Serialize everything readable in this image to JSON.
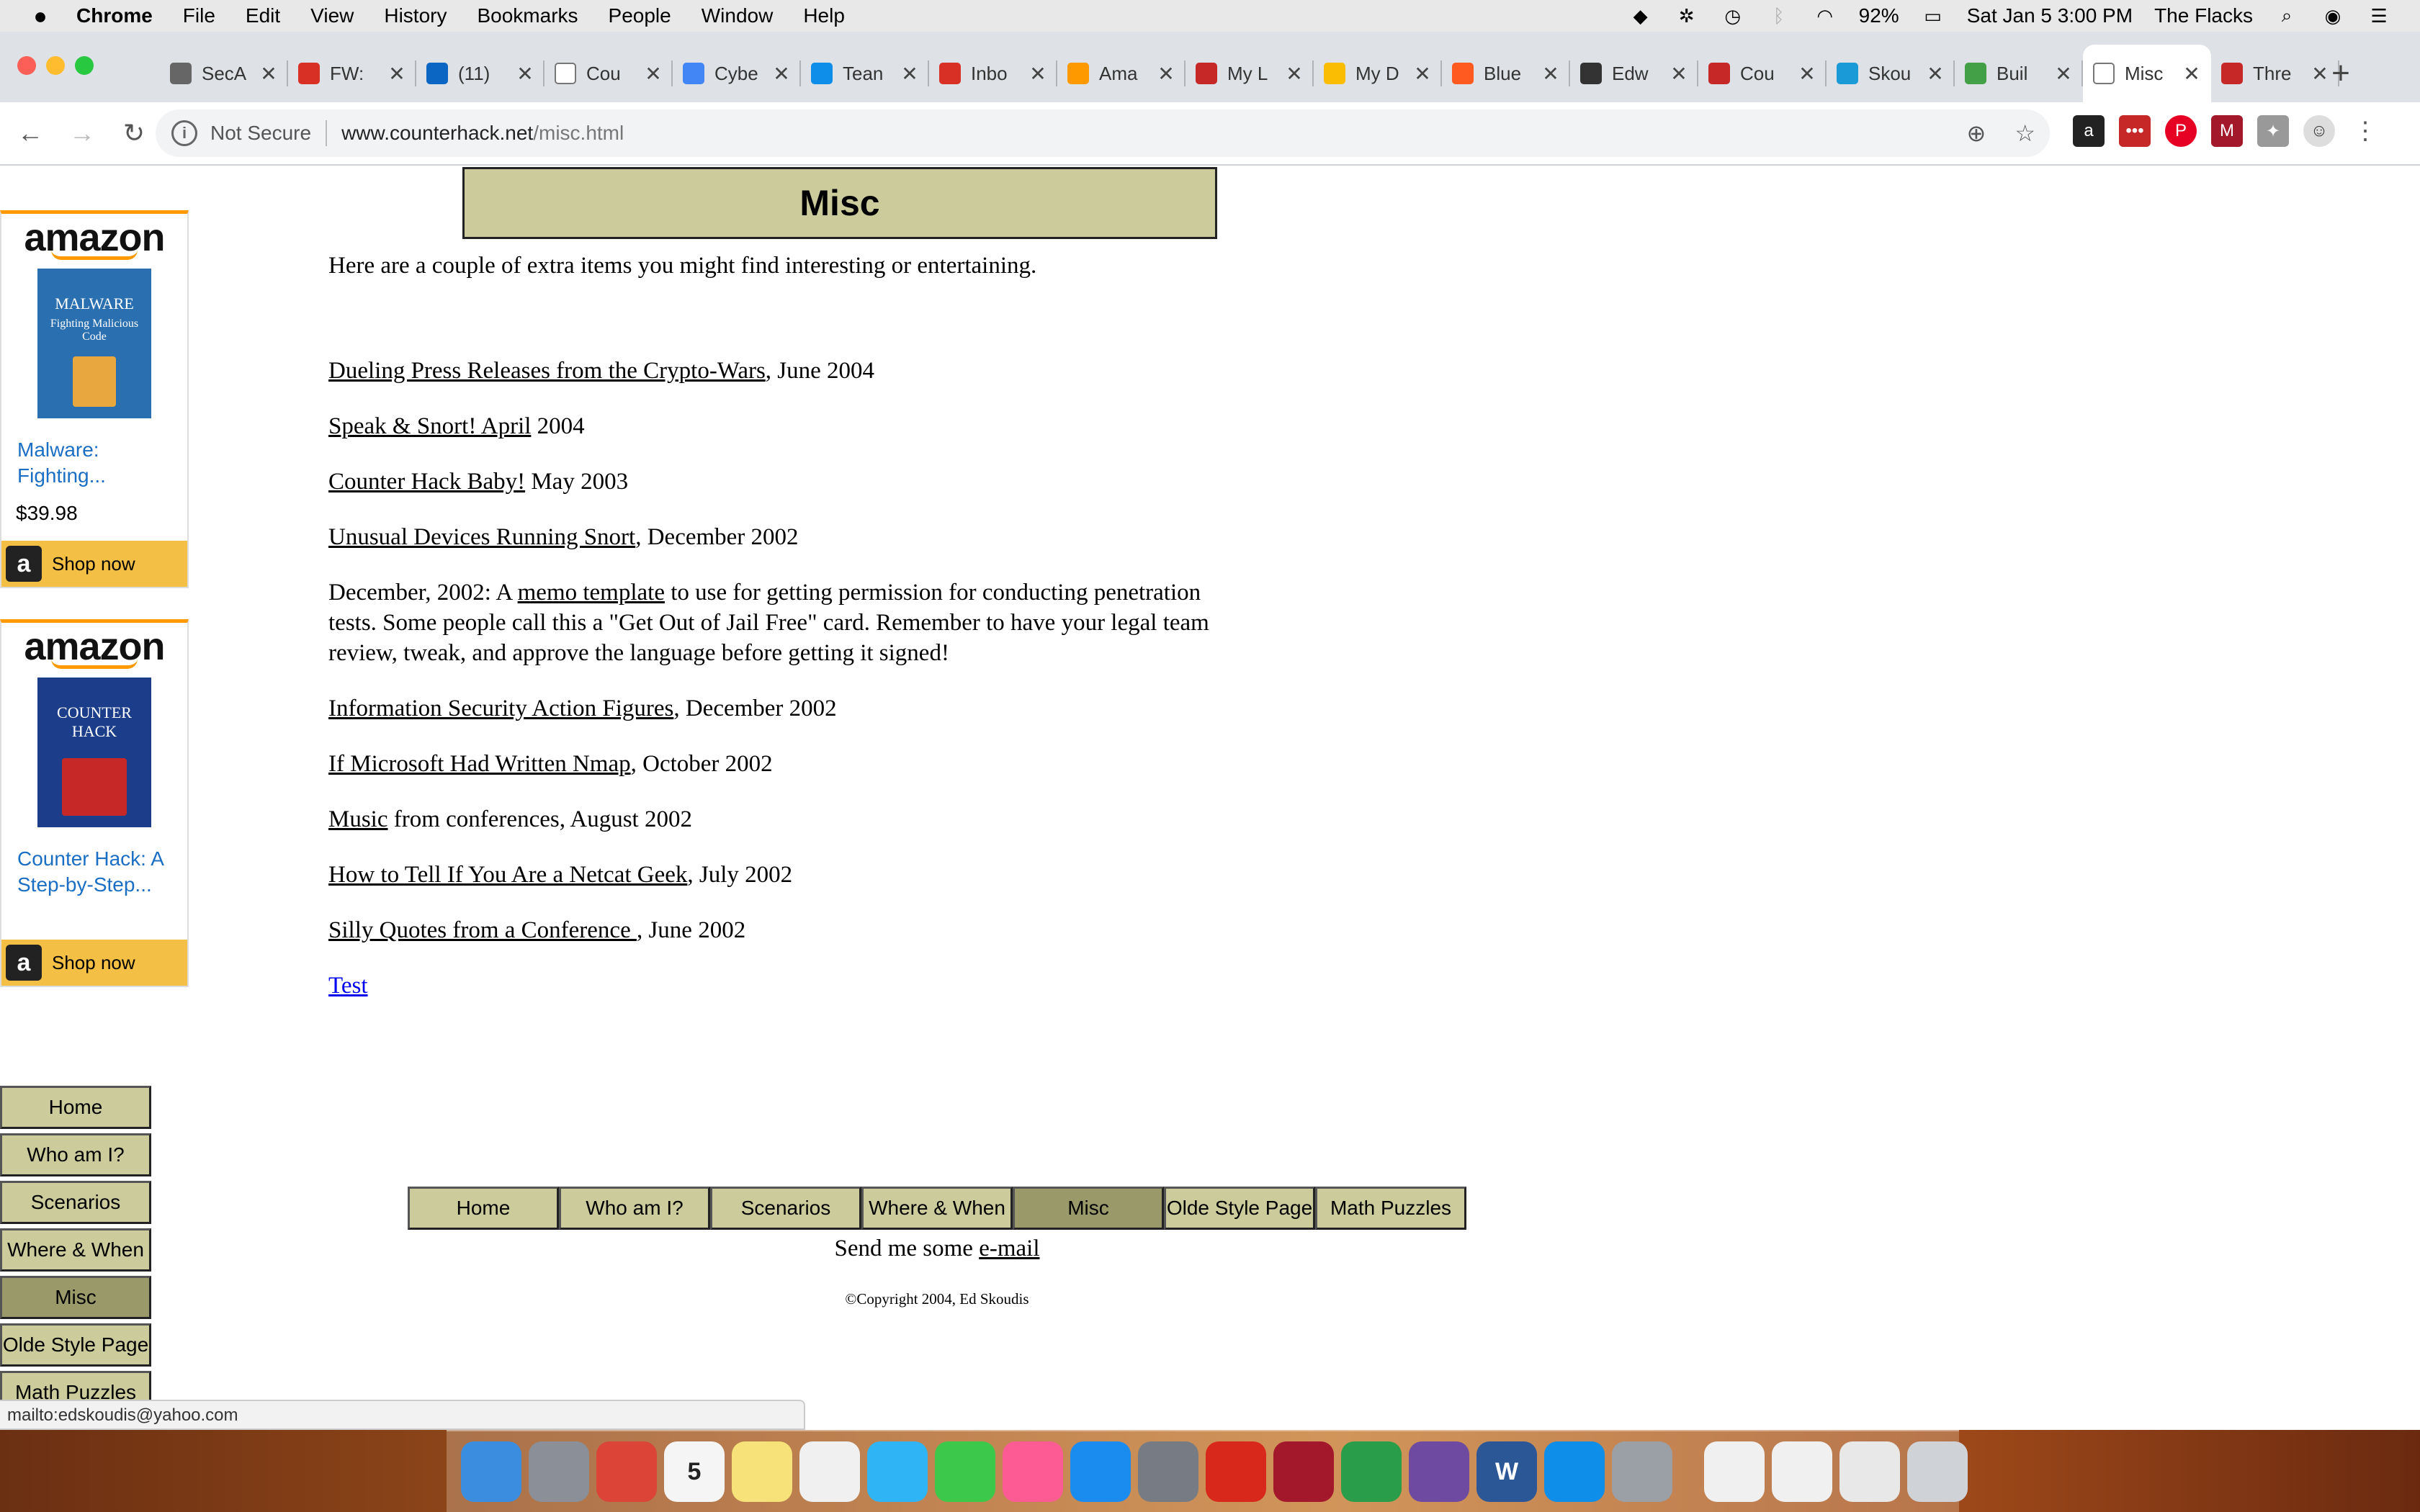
{
  "menubar": {
    "apple_icon": "",
    "items": [
      "Chrome",
      "File",
      "Edit",
      "View",
      "History",
      "Bookmarks",
      "People",
      "Window",
      "Help"
    ],
    "battery": "92%",
    "datetime": "Sat Jan 5  3:00 PM",
    "user": "The Flacks"
  },
  "tabs": [
    {
      "label": "SecA",
      "color": "#666666",
      "icon": "sec-icon"
    },
    {
      "label": "FW:",
      "color": "#d93025",
      "icon": "gmail-icon"
    },
    {
      "label": "(11)",
      "color": "#0a66c2",
      "icon": "linkedin-icon"
    },
    {
      "label": "Cou",
      "color": "#ffffff",
      "icon": "page-icon"
    },
    {
      "label": "Cybe",
      "color": "#4285f4",
      "icon": "docs-icon"
    },
    {
      "label": "Tean",
      "color": "#0e8ee9",
      "icon": "teamviewer-icon"
    },
    {
      "label": "Inbo",
      "color": "#d93025",
      "icon": "gmail-icon"
    },
    {
      "label": "Ama",
      "color": "#f90",
      "icon": "amazon-icon"
    },
    {
      "label": "My L",
      "color": "#c62828",
      "icon": "ext-icon"
    },
    {
      "label": "My D",
      "color": "#fbbc04",
      "icon": "drive-icon"
    },
    {
      "label": "Blue",
      "color": "#ff5a1f",
      "icon": "circle-icon"
    },
    {
      "label": "Edw",
      "color": "#333333",
      "icon": "flag-icon"
    },
    {
      "label": "Cou",
      "color": "#c62828",
      "icon": "dr-icon"
    },
    {
      "label": "Skou",
      "color": "#1a9bd7",
      "icon": "p-icon"
    },
    {
      "label": "Buil",
      "color": "#43a047",
      "icon": "user-icon"
    },
    {
      "label": "Misc",
      "color": "#ffffff",
      "icon": "page-icon",
      "active": true
    },
    {
      "label": "Thre",
      "color": "#c62828",
      "icon": "c-icon"
    }
  ],
  "toolbar": {
    "security_text": "Not Secure",
    "url_host": "www.counterhack.net",
    "url_path": "/misc.html"
  },
  "ads": [
    {
      "logo": "amazon",
      "book": "MALWARE",
      "book_sub": "Fighting Malicious Code",
      "title": "Malware: Fighting...",
      "price": "$39.98",
      "shop": "Shop now"
    },
    {
      "logo": "amazon",
      "book": "COUNTER HACK",
      "book_sub": "",
      "title": "Counter Hack: A Step-by-Step...",
      "price": "",
      "shop": "Shop now"
    }
  ],
  "nav": [
    "Home",
    "Who am I?",
    "Scenarios",
    "Where & When",
    "Misc",
    "Olde Style Page",
    "Math Puzzles"
  ],
  "page": {
    "header": "Misc",
    "intro": "Here are a couple of extra items you might find interesting or entertaining.",
    "items": [
      {
        "link": "Dueling Press Releases from the Crypto-Wars",
        "rest": ", June 2004"
      },
      {
        "link": "Speak & Snort! April",
        "rest": " 2004"
      },
      {
        "link": "Counter Hack Baby!",
        "rest": "  May 2003"
      },
      {
        "link": "Unusual Devices Running Snort",
        "rest": ", December 2002"
      },
      {
        "pre": "December, 2002: A ",
        "link": "memo template",
        "rest": " to use for getting permission for conducting penetration tests.  Some people call this a \"Get Out of Jail Free\" card.  Remember to have your legal team review, tweak, and approve the language before getting it signed!"
      },
      {
        "link": "Information Security Action Figures",
        "rest": ", December 2002"
      },
      {
        "link": "If Microsoft Had Written Nmap",
        "rest": ", October 2002"
      },
      {
        "link": "Music",
        "rest": " from conferences, August 2002"
      },
      {
        "link": "How to Tell If You Are a Netcat Geek",
        "rest": ", July 2002"
      },
      {
        "link": "Silly Quotes from a Conference ",
        "rest": ", June 2002"
      }
    ],
    "test_link": "Test",
    "email_pre": "Send me some ",
    "email_link": "e-mail",
    "copyright": "©Copyright 2004, Ed Skoudis"
  },
  "status_url": "mailto:edskoudis@yahoo.com",
  "dock": [
    {
      "name": "finder",
      "color": "#3b8de0"
    },
    {
      "name": "launchpad",
      "color": "#8a8f98"
    },
    {
      "name": "chrome",
      "color": "#db4437"
    },
    {
      "name": "calendar",
      "color": "#f5f5f5",
      "text": "5"
    },
    {
      "name": "notes",
      "color": "#f7e27a"
    },
    {
      "name": "reminders",
      "color": "#f0f0f0"
    },
    {
      "name": "messages",
      "color": "#2fb5f5"
    },
    {
      "name": "facetime",
      "color": "#3cc84a"
    },
    {
      "name": "itunes",
      "color": "#fc5b93"
    },
    {
      "name": "app-store",
      "color": "#1a8cf0"
    },
    {
      "name": "system-preferences",
      "color": "#777c84"
    },
    {
      "name": "acrobat",
      "color": "#d8281c"
    },
    {
      "name": "mendeley",
      "color": "#a3192b"
    },
    {
      "name": "keynote",
      "color": "#2a9d4a"
    },
    {
      "name": "github",
      "color": "#6e4aa0"
    },
    {
      "name": "word",
      "color": "#2b5797",
      "text": "W"
    },
    {
      "name": "teamviewer",
      "color": "#0e8ee9"
    },
    {
      "name": "snip",
      "color": "#9aa0a6"
    },
    {
      "name": "doc-txt",
      "color": "#f0f0f0"
    },
    {
      "name": "doc-word",
      "color": "#f0f0f0"
    },
    {
      "name": "doc-stack",
      "color": "#e8e8e8"
    },
    {
      "name": "trash",
      "color": "#cfd3d8"
    }
  ]
}
